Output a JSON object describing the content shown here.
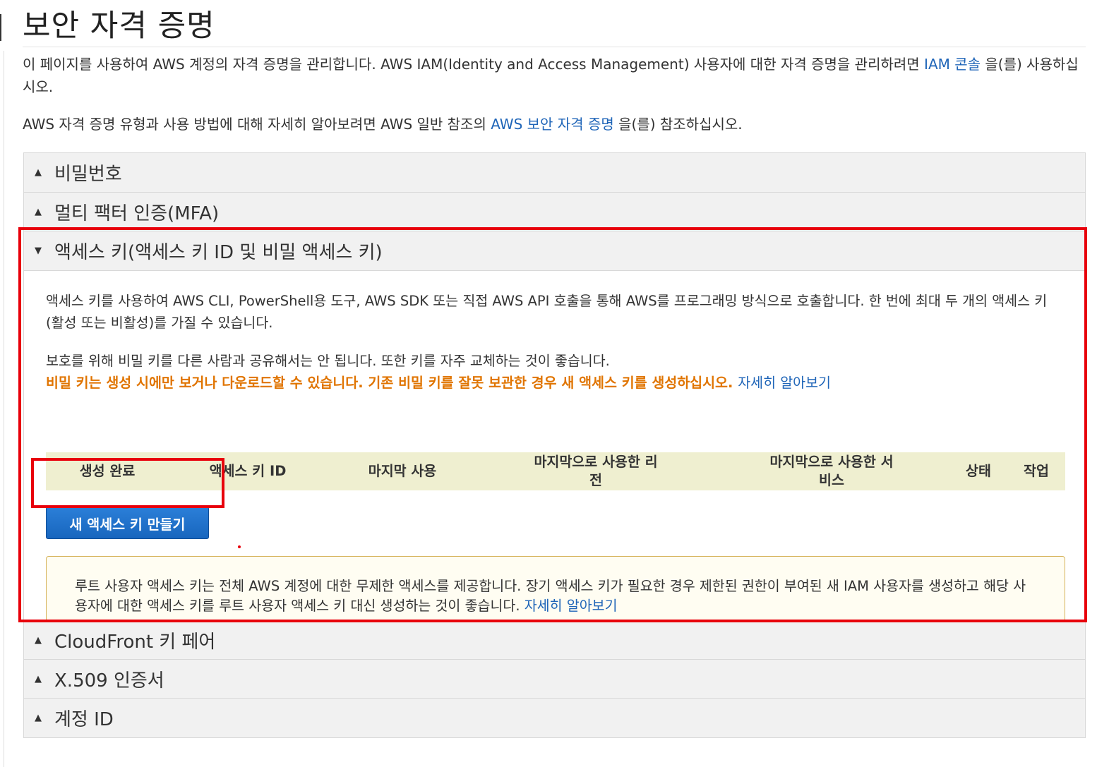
{
  "page": {
    "title": "보안 자격 증명",
    "intro1_prefix": "이 페이지를 사용하여 AWS 계정의 자격 증명을 관리합니다. AWS IAM(Identity and Access Management) 사용자에 대한 자격 증명을 관리하려면 ",
    "intro1_link": "IAM 콘솔",
    "intro1_suffix": " 을(를) 사용하십시오.",
    "intro2_prefix": "AWS 자격 증명 유형과 사용 방법에 대해 자세히 알아보려면 AWS 일반 참조의 ",
    "intro2_link": "AWS 보안 자격 증명",
    "intro2_suffix": " 을(를) 참조하십시오."
  },
  "sections": {
    "password": {
      "label": "비밀번호",
      "caret": "▲"
    },
    "mfa": {
      "label": "멀티 팩터 인증(MFA)",
      "caret": "▲"
    },
    "access_keys": {
      "label": "액세스 키(액세스 키 ID 및 비밀 액세스 키)",
      "caret": "▼"
    },
    "cloudfront": {
      "label": "CloudFront 키 페어",
      "caret": "▲"
    },
    "x509": {
      "label": "X.509 인증서",
      "caret": "▲"
    },
    "account_id": {
      "label": "계정 ID",
      "caret": "▲"
    }
  },
  "access_keys": {
    "desc1": "액세스 키를 사용하여 AWS CLI, PowerShell용 도구, AWS SDK 또는 직접 AWS API 호출을 통해 AWS를 프로그래밍 방식으로 호출합니다. 한 번에 최대 두 개의 액세스 키(활성 또는 비활성)를 가질 수 있습니다.",
    "desc2": "보호를 위해 비밀 키를 다른 사람과 공유해서는 안 됩니다. 또한 키를 자주 교체하는 것이 좋습니다.",
    "warning": "비밀 키는 생성 시에만 보거나 다운로드할 수 있습니다. 기존 비밀 키를 잘못 보관한 경우 새 액세스 키를 생성하십시오.",
    "learn_more": "자세히 알아보기",
    "columns": {
      "created": "생성 완료",
      "key_id": "액세스 키 ID",
      "last_used": "마지막 사용",
      "last_region": "마지막으로 사용한 리전",
      "last_service": "마지막으로 사용한 서비스",
      "status": "상태",
      "actions": "작업"
    },
    "create_button": "새 액세스 키 만들기",
    "info": "루트 사용자 액세스 키는 전체 AWS 계정에 대한 무제한 액세스를 제공합니다. 장기 액세스 키가 필요한 경우 제한된 권한이 부여된 새 IAM 사용자를 생성하고 해당 사용자에 대한 액세스 키를 루트 사용자 액세스 키 대신 생성하는 것이 좋습니다. ",
    "info_link": "자세히 알아보기"
  },
  "colors": {
    "link": "#1f65b8",
    "warning": "#e07400",
    "highlight": "#e8000b",
    "button": "#1866be",
    "table_header_bg": "#efefd0"
  }
}
